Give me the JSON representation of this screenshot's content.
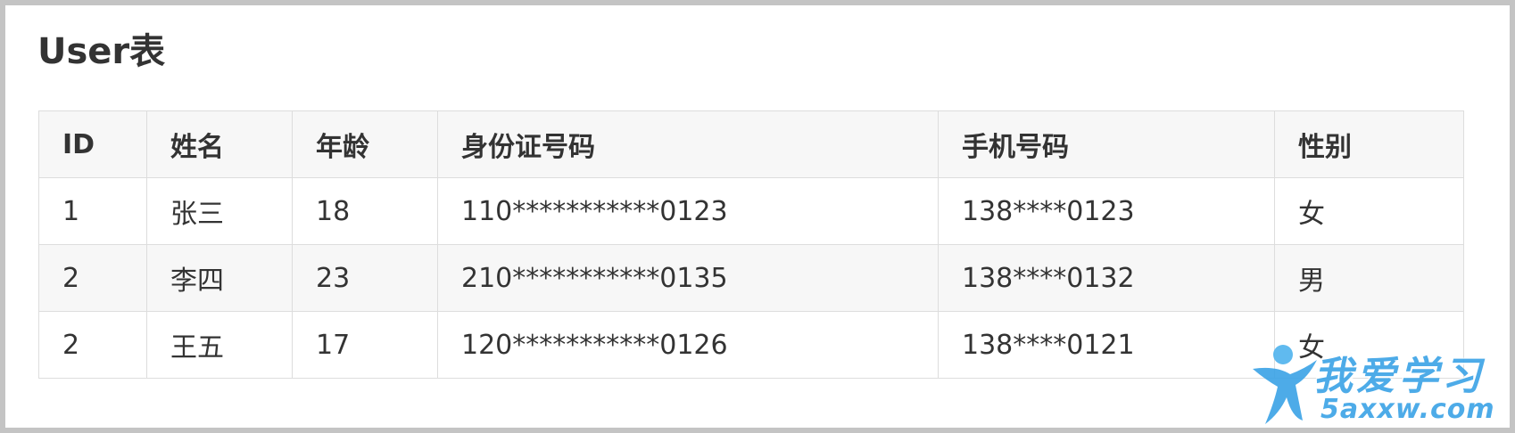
{
  "page": {
    "title": "User表"
  },
  "table": {
    "headers": [
      "ID",
      "姓名",
      "年龄",
      "身份证号码",
      "手机号码",
      "性别"
    ],
    "rows": [
      [
        "1",
        "张三",
        "18",
        "110***********0123",
        "138****0123",
        "女"
      ],
      [
        "2",
        "李四",
        "23",
        "210***********0135",
        "138****0132",
        "男"
      ],
      [
        "2",
        "王五",
        "17",
        "120***********0126",
        "138****0121",
        "女"
      ]
    ]
  },
  "watermark": {
    "main": "我爱学习",
    "site": "5axxw.com",
    "icon": "running-person-icon"
  },
  "colors": {
    "text": "#333333",
    "border": "#dddddd",
    "stripe": "#f7f7f7",
    "frame": "#c4c4c4",
    "watermark": "#3aa3e6"
  }
}
